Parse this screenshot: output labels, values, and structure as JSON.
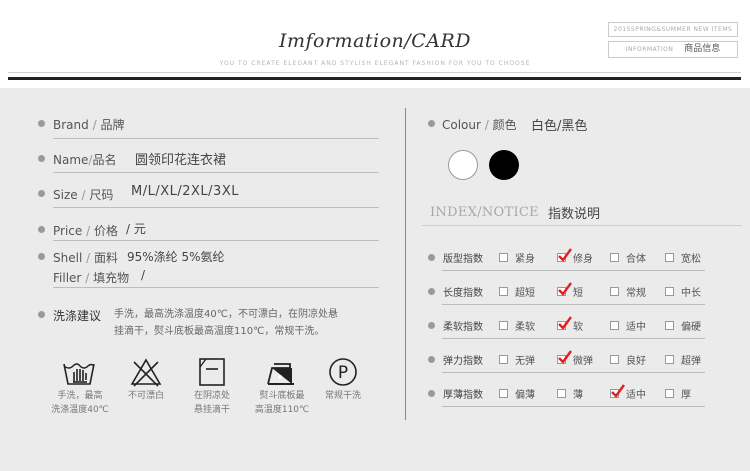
{
  "header": {
    "title": "Imformation/CARD",
    "subtitle": "YOU TO CREATE ELEGANT AND STYLISH ELEGANT FASHION FOR YOU TO CHOOSE",
    "tag_season": "2015SPRING&SUMMER NEW ITEMS",
    "tag_info_en": "INFORMATION",
    "tag_info_cn": "商品信息"
  },
  "left": {
    "brand": {
      "label_en": "Brand",
      "sep": "/",
      "label_cn": "品牌",
      "value": ""
    },
    "name": {
      "label_en": "Name",
      "sep": "/",
      "label_cn": "品名",
      "value": "圆领印花连衣裙"
    },
    "size": {
      "label_en": "Size",
      "sep": "/",
      "label_cn": "尺码",
      "value": "M/L/XL/2XL/3XL"
    },
    "price": {
      "label_en": "Price",
      "sep": "/",
      "label_cn": "价格",
      "value": "/ 元"
    },
    "shell": {
      "label_en": "Shell",
      "sep": "/",
      "label_cn": "面料",
      "value": "95%涤纶 5%氨纶"
    },
    "filler": {
      "label_en": "Filler",
      "sep": "/",
      "label_cn": "填充物",
      "value": "/"
    },
    "care": {
      "label": "洗涤建议",
      "line1": "手洗，最高洗涤温度40℃，不可漂白，在阴凉处悬",
      "line2": "挂滴干，熨斗底板最高温度110℃，常规干洗。"
    },
    "care_icons": [
      {
        "icon": "hand-wash-icon",
        "cap1": "手洗，最高",
        "cap2": "洗涤温度40℃"
      },
      {
        "icon": "no-bleach-icon",
        "cap1": "不可漂白",
        "cap2": ""
      },
      {
        "icon": "line-dry-shade-icon",
        "cap1": "在阴凉处",
        "cap2": "悬挂滴干"
      },
      {
        "icon": "iron-icon",
        "cap1": "熨斗底板最",
        "cap2": "高温度110℃"
      },
      {
        "icon": "dry-clean-p-icon",
        "glyph": "P",
        "cap1": "常规干洗",
        "cap2": ""
      }
    ]
  },
  "right": {
    "colour": {
      "label_en": "Colour",
      "sep": "/",
      "label_cn": "颜色",
      "value": "白色/黑色"
    },
    "swatches": [
      {
        "name": "white",
        "color": "#ffffff"
      },
      {
        "name": "black",
        "color": "#000000"
      }
    ],
    "index_title_en": "INDEX/NOTICE",
    "index_title_cn": "指数说明",
    "check_color": "#e02020",
    "rows": [
      {
        "name": "版型指数",
        "options": [
          {
            "label": "紧身",
            "checked": false
          },
          {
            "label": "修身",
            "checked": true
          },
          {
            "label": "合体",
            "checked": false
          },
          {
            "label": "宽松",
            "checked": false
          }
        ]
      },
      {
        "name": "长度指数",
        "options": [
          {
            "label": "超短",
            "checked": false
          },
          {
            "label": "短",
            "checked": true
          },
          {
            "label": "常规",
            "checked": false
          },
          {
            "label": "中长",
            "checked": false
          }
        ]
      },
      {
        "name": "柔软指数",
        "options": [
          {
            "label": "柔软",
            "checked": false
          },
          {
            "label": "软",
            "checked": true
          },
          {
            "label": "适中",
            "checked": false
          },
          {
            "label": "偏硬",
            "checked": false
          }
        ]
      },
      {
        "name": "弹力指数",
        "options": [
          {
            "label": "无弹",
            "checked": false
          },
          {
            "label": "微弹",
            "checked": true
          },
          {
            "label": "良好",
            "checked": false
          },
          {
            "label": "超弹",
            "checked": false
          }
        ]
      },
      {
        "name": "厚薄指数",
        "options": [
          {
            "label": "偏薄",
            "checked": false
          },
          {
            "label": "薄",
            "checked": false
          },
          {
            "label": "适中",
            "checked": true
          },
          {
            "label": "厚",
            "checked": false
          }
        ]
      }
    ]
  }
}
